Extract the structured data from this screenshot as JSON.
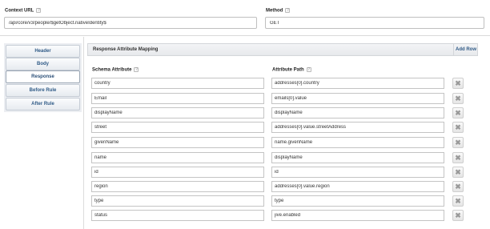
{
  "context_url": {
    "label": "Context URL",
    "value": "/api/core/v3/people/$getObject.nativeIdentity$"
  },
  "method": {
    "label": "Method",
    "value": "GET"
  },
  "help_glyph": "?",
  "side_nav": {
    "items": [
      {
        "label": "Header",
        "active": false
      },
      {
        "label": "Body",
        "active": false
      },
      {
        "label": "Response",
        "active": true
      },
      {
        "label": "Before Rule",
        "active": false
      },
      {
        "label": "After Rule",
        "active": false
      }
    ]
  },
  "mapping": {
    "title": "Response Attribute Mapping",
    "add_row_label": "Add Row",
    "schema_header": "Schema Attribute",
    "path_header": "Attribute Path",
    "delete_glyph": "✖",
    "rows": [
      {
        "schema": "country",
        "path": "addresses[0].country"
      },
      {
        "schema": "Email",
        "path": "emails[0].value"
      },
      {
        "schema": "displayName",
        "path": "displayName"
      },
      {
        "schema": "street",
        "path": "addresses[0].value.streetAddress"
      },
      {
        "schema": "givenName",
        "path": "name.givenName"
      },
      {
        "schema": "name",
        "path": "displayName"
      },
      {
        "schema": "id",
        "path": "id"
      },
      {
        "schema": "region",
        "path": "addresses[0].value.region"
      },
      {
        "schema": "type",
        "path": "type"
      },
      {
        "schema": "status",
        "path": "jive.enabled"
      }
    ]
  }
}
